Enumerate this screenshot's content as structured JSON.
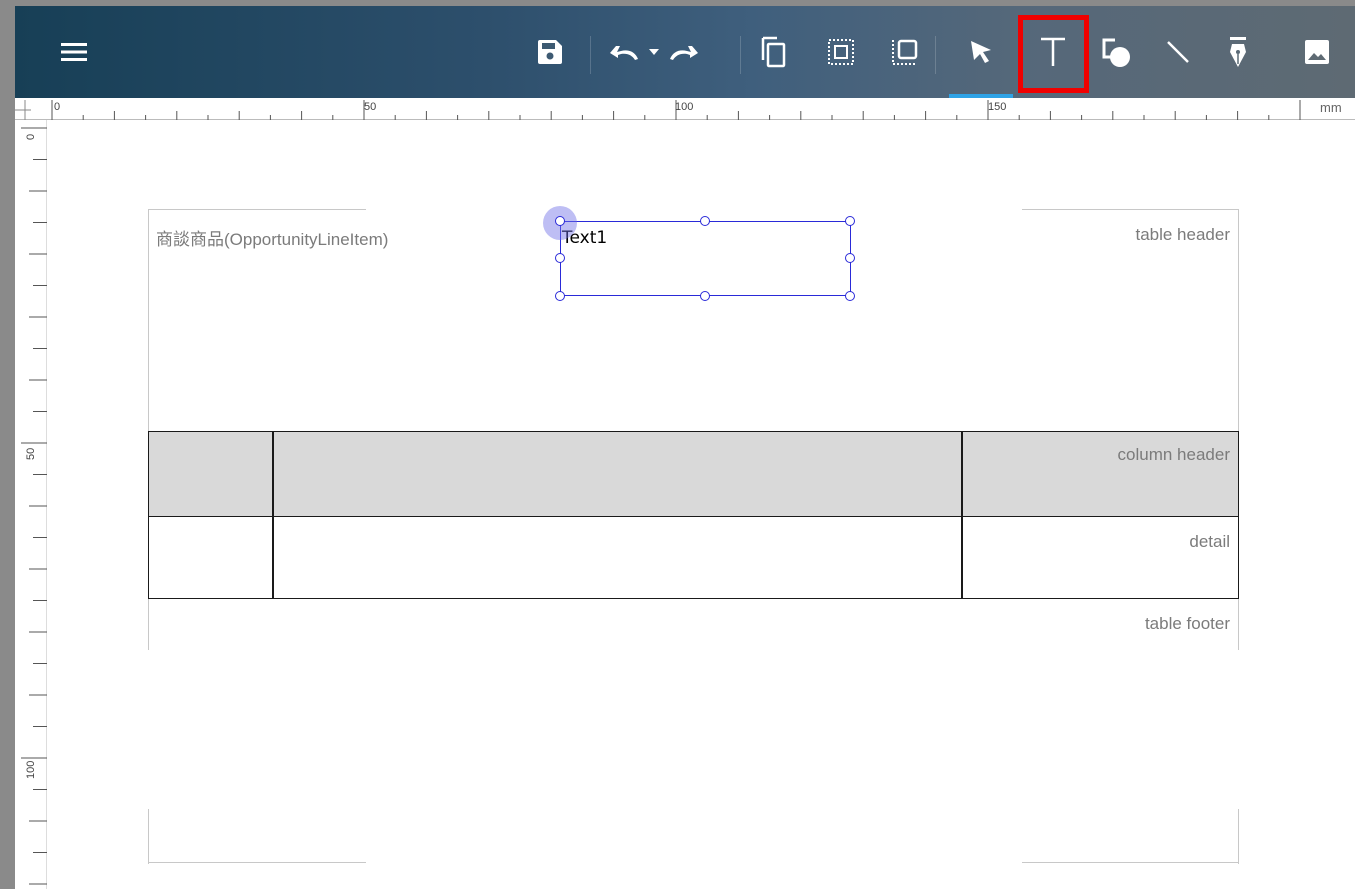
{
  "toolbar": {
    "menu_icon": "hamburger-menu-icon",
    "tools": [
      {
        "name": "save",
        "icon": "save-icon"
      },
      {
        "name": "undo",
        "icon": "undo-icon"
      },
      {
        "name": "undo-history",
        "icon": "caret-down-icon"
      },
      {
        "name": "redo",
        "icon": "redo-icon"
      },
      {
        "name": "copy",
        "icon": "copy-icon"
      },
      {
        "name": "group",
        "icon": "group-icon"
      },
      {
        "name": "ungroup",
        "icon": "ungroup-icon"
      },
      {
        "name": "select",
        "icon": "pointer-icon",
        "active": true
      },
      {
        "name": "text",
        "icon": "text-tool-icon",
        "highlighted": true
      },
      {
        "name": "shape",
        "icon": "shape-icon"
      },
      {
        "name": "line",
        "icon": "line-icon"
      },
      {
        "name": "pen",
        "icon": "pen-icon"
      },
      {
        "name": "image",
        "icon": "image-icon"
      }
    ],
    "colors": {
      "accent_underline": "#2fa3e6",
      "highlight_box": "#f00000"
    }
  },
  "ruler": {
    "top_labels": [
      "0",
      "50",
      "100",
      "150"
    ],
    "unit": "mm",
    "left_labels": [
      "0",
      "50",
      "100"
    ]
  },
  "canvas": {
    "table_title": "商談商品(OpportunityLineItem)",
    "table_header_label": "table header",
    "column_header_label": "column header",
    "detail_label": "detail",
    "table_footer_label": "table footer",
    "column_header_fill": "#d9d9d9",
    "selection_color": "#2a2ad8"
  },
  "selected_element": {
    "text": "Text1"
  }
}
